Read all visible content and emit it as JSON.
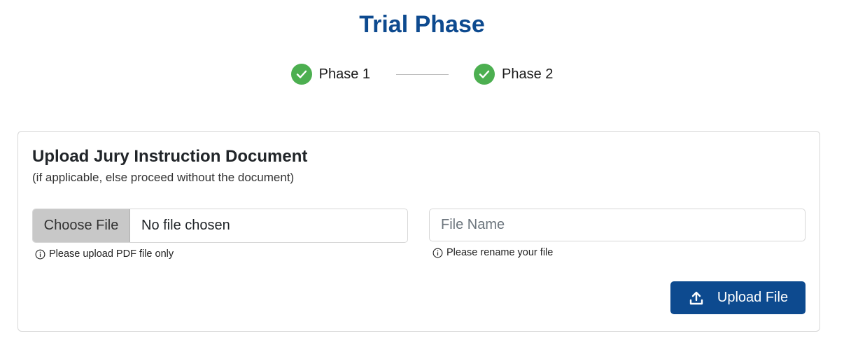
{
  "page": {
    "title": "Trial Phase"
  },
  "stepper": {
    "steps": [
      {
        "label": "Phase 1",
        "status": "completed",
        "icon": "check-icon"
      },
      {
        "label": "Phase 2",
        "status": "completed",
        "icon": "check-icon"
      }
    ]
  },
  "upload_card": {
    "title": "Upload Jury Instruction Document",
    "subtitle": "(if applicable, else proceed without the document)",
    "file_input": {
      "button_label": "Choose File",
      "status_text": "No file chosen",
      "hint": "Please upload PDF file only",
      "hint_icon": "info-icon"
    },
    "file_name": {
      "value": "",
      "placeholder": "File Name",
      "hint": "Please rename your file",
      "hint_icon": "info-icon"
    },
    "upload_button": {
      "label": "Upload File",
      "icon": "upload-icon"
    }
  },
  "colors": {
    "brand": "#0d4a8f",
    "success": "#4caf50",
    "border": "#d7d7d7"
  }
}
